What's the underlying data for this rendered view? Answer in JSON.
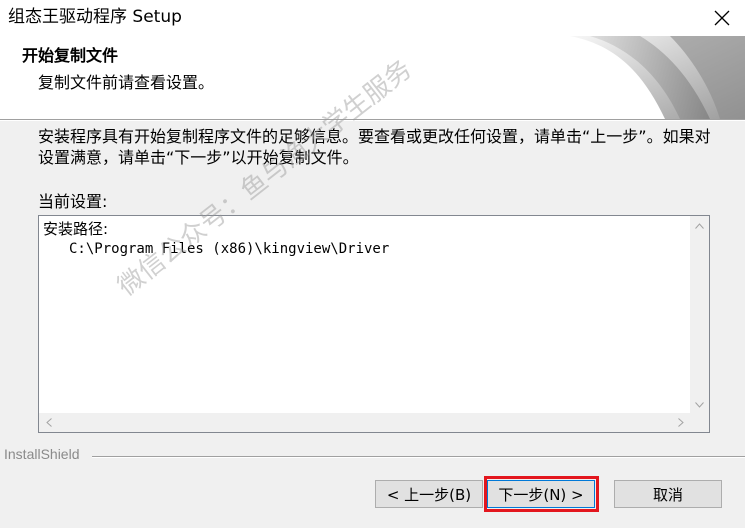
{
  "window": {
    "title": "组态王驱动程序 Setup"
  },
  "header": {
    "title": "开始复制文件",
    "subtitle": "复制文件前请查看设置。"
  },
  "description": "安装程序具有开始复制程序文件的足够信息。要查看或更改任何设置，请单击“上一步”。如果对设置满意，请单击“下一步”以开始复制文件。",
  "current_settings": {
    "label": "当前设置:",
    "lines": [
      "安装路径:",
      "C:\\Program Files (x86)\\kingview\\Driver"
    ]
  },
  "brand": "InstallShield",
  "buttons": {
    "back": "< 上一步(B)",
    "next": "下一步(N) >",
    "cancel": "取消"
  },
  "watermark": "微信公众号：鱼与渔大学生服务",
  "colors": {
    "highlight": "#e3161e",
    "focus_border": "#0078d7"
  }
}
